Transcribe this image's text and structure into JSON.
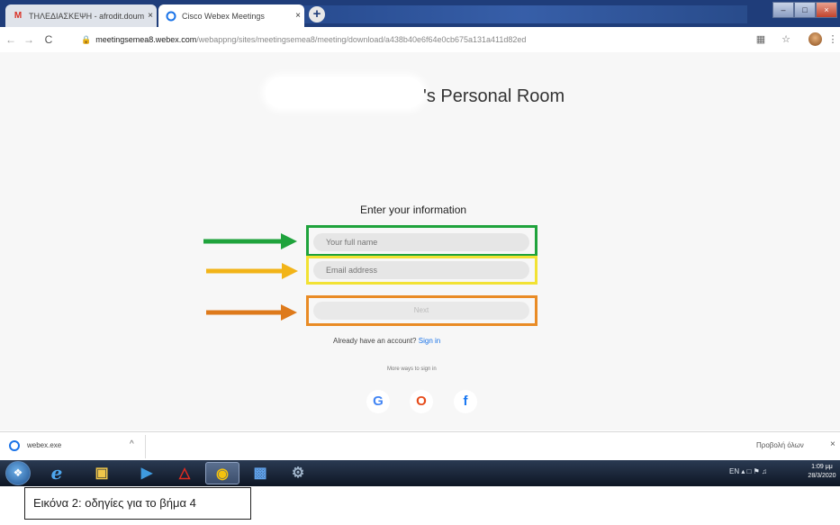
{
  "browser": {
    "tabs": [
      {
        "title": "ΤΗΛΕΔΙΑΣΚΕΨΗ - afrodit.doum",
        "close": "×"
      },
      {
        "title": "Cisco Webex Meetings",
        "close": "×"
      }
    ],
    "new_tab": "+",
    "window_buttons": {
      "minimize": "–",
      "maximize": "□",
      "close": "×"
    },
    "nav": {
      "back": "←",
      "forward": "→",
      "reload": "C"
    },
    "url_host": "meetingsemea8.webex.com",
    "url_path": "/webappng/sites/meetingsemea8/meeting/download/a438b40e6f64e0cb675a131a411d82ed",
    "toolbar_icons": [
      "translate-icon",
      "star-icon",
      "profile-avatar"
    ]
  },
  "page": {
    "room_title": "'s Personal Room",
    "form_heading": "Enter your information",
    "name_placeholder": "Your full name",
    "email_placeholder": "Email address",
    "next_label": "Next",
    "account_prompt": "Already have an account?",
    "sign_in_label": "Sign in",
    "more_ways": "More ways to sign in",
    "social": {
      "google": "G",
      "office": "O",
      "facebook": "f"
    },
    "colors": {
      "green": "#1fa33c",
      "yellow": "#f2e233",
      "orange": "#e98b25"
    }
  },
  "downloads": {
    "file_name": "webex.exe",
    "caret": "^",
    "show_all": "Προβολή όλων",
    "close": "×"
  },
  "taskbar": {
    "tray_text": "EN",
    "time": "1:09 μμ",
    "date": "28/3/2020"
  },
  "caption": "Εικόνα 2: οδηγίες για το βήμα  4"
}
